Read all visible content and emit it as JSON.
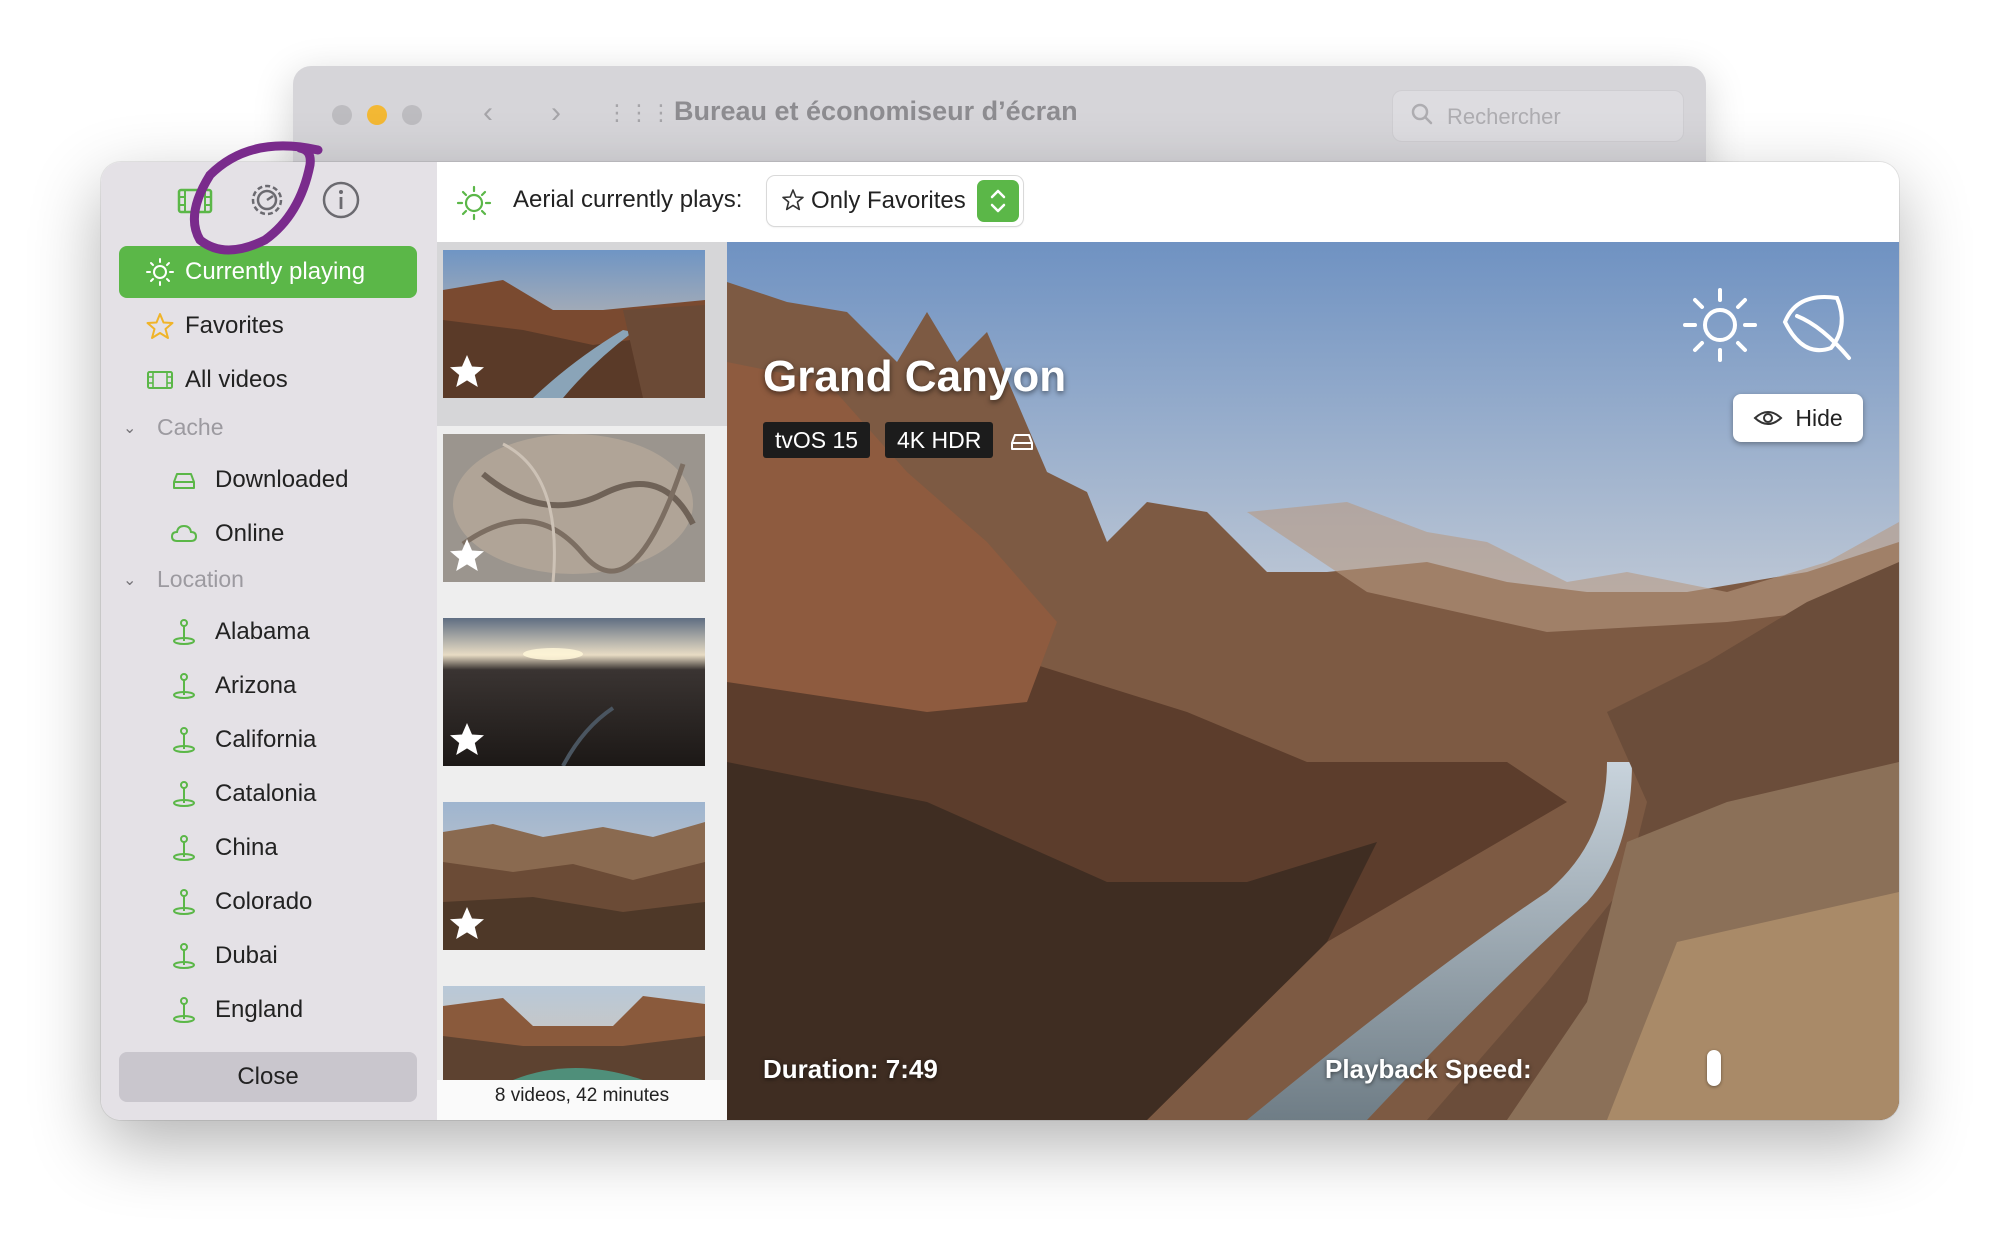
{
  "background_window": {
    "title": "Bureau et économiseur d’écran",
    "search_placeholder": "Rechercher"
  },
  "sidebar": {
    "tabs": [
      {
        "icon": "film-icon"
      },
      {
        "icon": "gear-icon"
      },
      {
        "icon": "info-icon"
      }
    ],
    "items": [
      {
        "label": "Currently playing",
        "icon": "sun-icon",
        "active": true
      },
      {
        "label": "Favorites",
        "icon": "star-icon"
      },
      {
        "label": "All videos",
        "icon": "film-icon"
      }
    ],
    "cache_section": "Cache",
    "cache_items": [
      {
        "label": "Downloaded",
        "icon": "drive-icon"
      },
      {
        "label": "Online",
        "icon": "cloud-icon"
      }
    ],
    "location_section": "Location",
    "locations": [
      "Alabama",
      "Arizona",
      "California",
      "Catalonia",
      "China",
      "Colorado",
      "Dubai",
      "England"
    ],
    "close_label": "Close"
  },
  "toolbar": {
    "label": "Aerial currently plays:",
    "popup_value": "Only Favorites"
  },
  "thumbnails": {
    "count_text": "8 videos, 42 minutes",
    "items": [
      {
        "favorite": true,
        "selected": true
      },
      {
        "favorite": true
      },
      {
        "favorite": true
      },
      {
        "favorite": true
      },
      {
        "favorite": false
      }
    ]
  },
  "preview": {
    "title": "Grand Canyon",
    "badges": [
      "tvOS 15",
      "4K HDR"
    ],
    "hide_label": "Hide",
    "duration": "Duration: 7:49",
    "speed_label": "Playback Speed:"
  },
  "colors": {
    "accent": "#5bb748",
    "sidebar_bg": "#e4e1e6",
    "annotation": "#7a2b8c"
  }
}
